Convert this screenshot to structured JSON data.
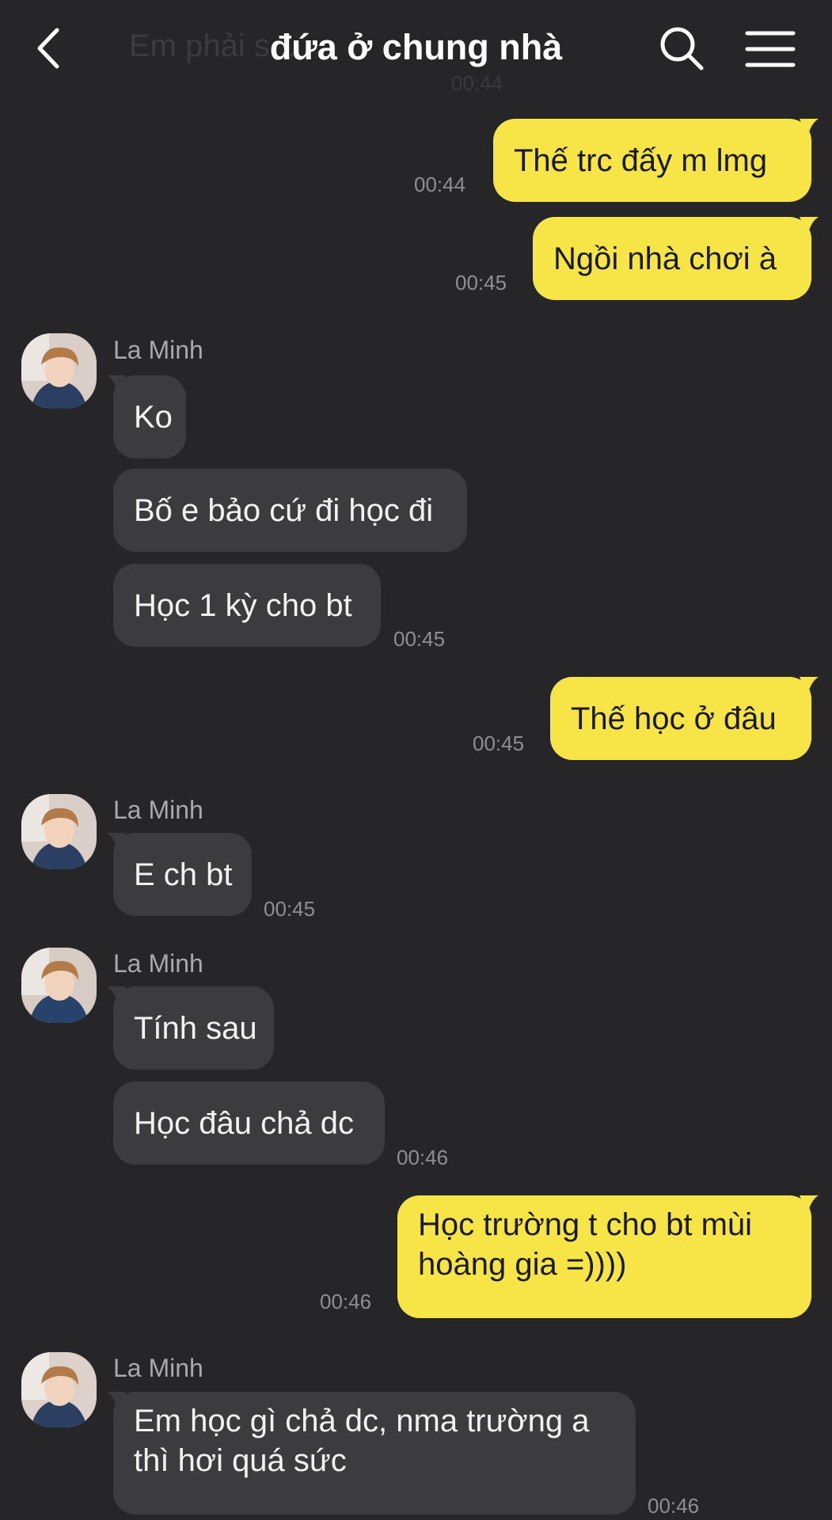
{
  "header": {
    "title": "đứa ở chung nhà",
    "ghost_preview": "Em phải s...",
    "ghost_time": "00:44"
  },
  "messages": [
    {
      "from": "me",
      "text": "Thế trc đấy m lmg",
      "time": "00:44"
    },
    {
      "from": "me",
      "text": "Ngồi nhà chơi à",
      "time": "00:45"
    },
    {
      "from": "other",
      "sender": "La Minh",
      "text": "Ko"
    },
    {
      "from": "other",
      "text": "Bố e bảo cứ đi học đi"
    },
    {
      "from": "other",
      "text": "Học 1 kỳ cho bt",
      "time": "00:45"
    },
    {
      "from": "me",
      "text": "Thế học ở đâu",
      "time": "00:45"
    },
    {
      "from": "other",
      "sender": "La Minh",
      "text": "E ch bt",
      "time": "00:45"
    },
    {
      "from": "other",
      "sender": "La Minh",
      "text": "Tính sau"
    },
    {
      "from": "other",
      "text": "Học đâu chả dc",
      "time": "00:46"
    },
    {
      "from": "me",
      "text": "Học trường t cho bt mùi hoàng gia =))))",
      "time": "00:46"
    },
    {
      "from": "other",
      "sender": "La Minh",
      "text": "Em học gì chả dc, nma trường a thì hơi quá sức",
      "time": "00:46"
    }
  ],
  "colors": {
    "background": "#262628",
    "my_bubble": "#f7e547",
    "their_bubble": "#3c3c3e",
    "timestamp": "#8e8e93"
  },
  "icons": [
    "back-arrow-icon",
    "search-icon",
    "menu-icon"
  ]
}
